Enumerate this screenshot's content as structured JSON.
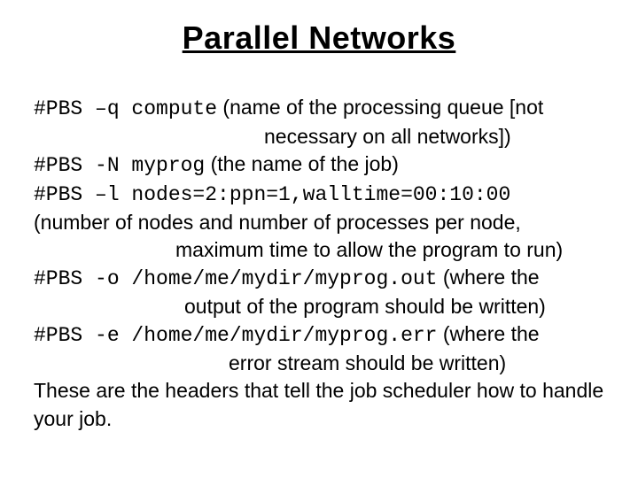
{
  "title": "Parallel Networks",
  "lines": {
    "l1_code": "#PBS –q compute",
    "l1_text": " (name of the processing queue [not",
    "l2_text": "necessary on all networks])",
    "l3_code": "#PBS -N myprog",
    "l3_text": " (the name of the job)",
    "l4_code": "#PBS –l nodes=2:ppn=1,walltime=00:10:00",
    "l5_text": "(number of nodes and number of processes per node,",
    "l6_text": "maximum time to allow the program to run)",
    "l7_code": "#PBS -o /home/me/mydir/myprog.out",
    "l7_text": " (where the",
    "l8_text": "output of the program should be written)",
    "l9_code": "#PBS -e /home/me/mydir/myprog.err",
    "l9_text": " (where the",
    "l10_text": "error stream should be written)",
    "l11_text": "These are the headers that tell the job scheduler how to handle your job."
  }
}
